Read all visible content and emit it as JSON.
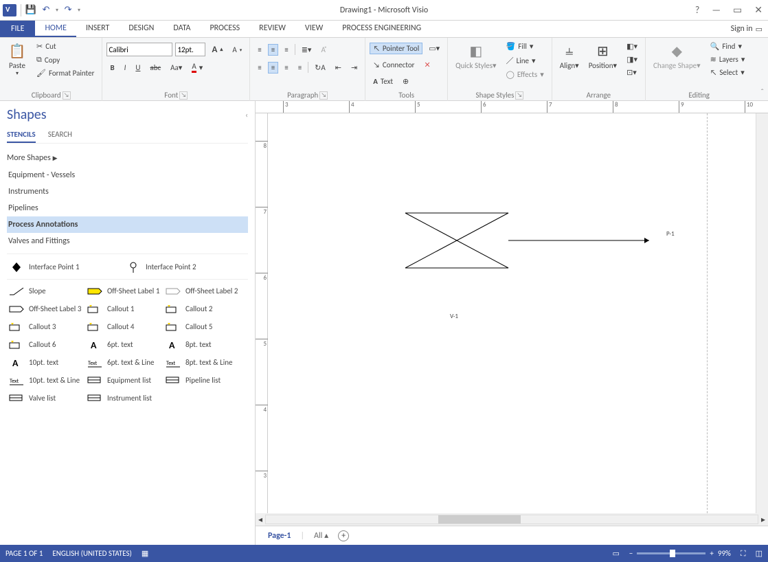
{
  "title": "Drawing1 - Microsoft Visio",
  "qat": {
    "save": "💾",
    "undo": "↶",
    "redo": "↷"
  },
  "window": {
    "help": "?",
    "min": "—",
    "max": "▭",
    "close": "✕"
  },
  "tabs": {
    "file": "FILE",
    "items": [
      "HOME",
      "INSERT",
      "DESIGN",
      "DATA",
      "PROCESS",
      "REVIEW",
      "VIEW",
      "PROCESS ENGINEERING"
    ],
    "active": "HOME",
    "signin": "Sign in"
  },
  "ribbon": {
    "clipboard": {
      "label": "Clipboard",
      "paste": "Paste",
      "cut": "Cut",
      "copy": "Copy",
      "format_painter": "Format Painter"
    },
    "font": {
      "label": "Font",
      "name": "Calibri",
      "size": "12pt."
    },
    "paragraph": {
      "label": "Paragraph"
    },
    "tools": {
      "label": "Tools",
      "pointer": "Pointer Tool",
      "connector": "Connector",
      "text": "Text"
    },
    "shape_styles": {
      "label": "Shape Styles",
      "quick": "Quick Styles",
      "fill": "Fill",
      "line": "Line",
      "effects": "Effects"
    },
    "arrange": {
      "label": "Arrange",
      "align": "Align",
      "position": "Position"
    },
    "editing": {
      "label": "Editing",
      "change": "Change Shape",
      "find": "Find",
      "layers": "Layers",
      "select": "Select"
    }
  },
  "shapes_panel": {
    "title": "Shapes",
    "tab_stencils": "STENCILS",
    "tab_search": "SEARCH",
    "more": "More Shapes",
    "stencils": [
      "Equipment - Vessels",
      "Instruments",
      "Pipelines",
      "Process Annotations",
      "Valves and Fittings"
    ],
    "active_stencil": "Process Annotations",
    "master_row": [
      {
        "n": "Interface Point 1"
      },
      {
        "n": "Interface Point 2"
      }
    ],
    "masters": [
      {
        "n": "Slope"
      },
      {
        "n": "Off-Sheet Label 1"
      },
      {
        "n": "Off-Sheet Label 2"
      },
      {
        "n": "Off-Sheet Label 3"
      },
      {
        "n": "Callout 1"
      },
      {
        "n": "Callout 2"
      },
      {
        "n": "Callout 3"
      },
      {
        "n": "Callout 4"
      },
      {
        "n": "Callout 5"
      },
      {
        "n": "Callout 6"
      },
      {
        "n": "6pt. text"
      },
      {
        "n": "8pt. text"
      },
      {
        "n": "10pt. text"
      },
      {
        "n": "6pt. text & Line"
      },
      {
        "n": "8pt. text & Line"
      },
      {
        "n": "10pt. text & Line"
      },
      {
        "n": "Equipment list"
      },
      {
        "n": "Pipeline list"
      },
      {
        "n": "Valve list"
      },
      {
        "n": "Instrument list"
      }
    ]
  },
  "canvas": {
    "hruler": [
      3,
      4,
      5,
      6,
      7,
      8,
      9,
      10
    ],
    "vruler": [
      8,
      7,
      6,
      5,
      4,
      3
    ],
    "shape_label": "V-1",
    "pipe_label": "P-1"
  },
  "pages": {
    "page1": "Page-1",
    "all": "All",
    "add": "+"
  },
  "status": {
    "page": "PAGE 1 OF 1",
    "lang": "ENGLISH (UNITED STATES)",
    "zoom": "99%"
  }
}
